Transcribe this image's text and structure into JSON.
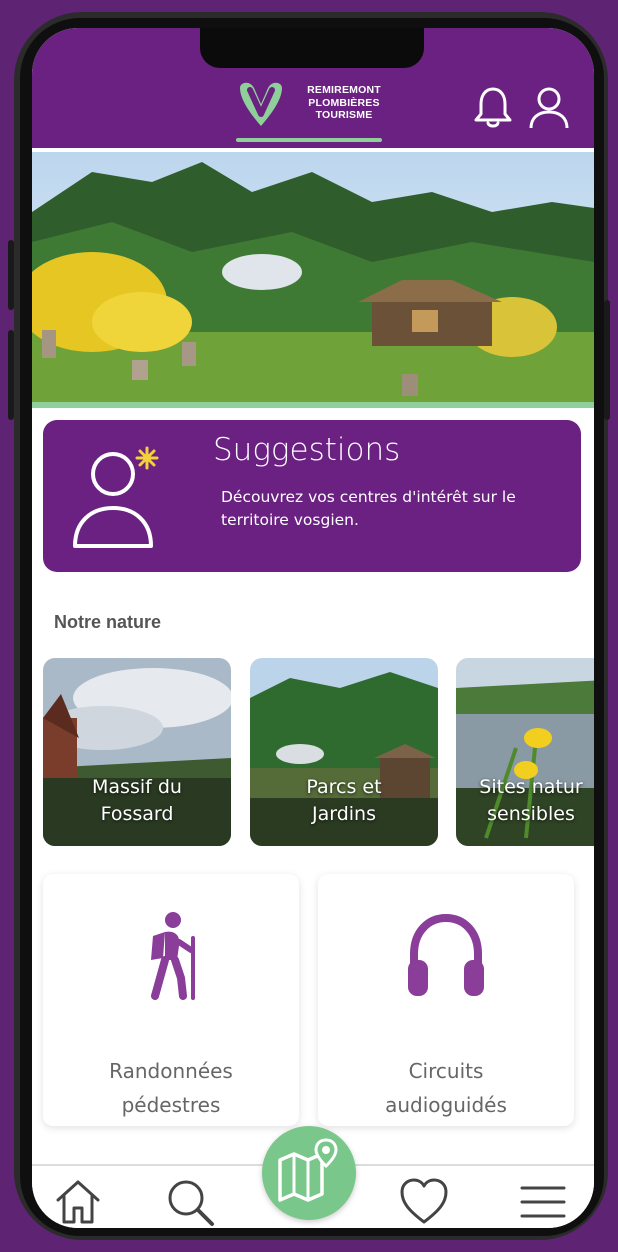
{
  "header": {
    "logo_lines": [
      "REMIREMONT",
      "PLOMBIÈRES",
      "TOURISME"
    ],
    "icons": [
      "bell-icon",
      "user-icon"
    ]
  },
  "hero": {
    "icon": "garden-photo"
  },
  "suggestions": {
    "title": "Suggestions",
    "text": "Découvrez vos centres d'intérêt sur le territoire vosgien.",
    "icon": "user-sparkle-icon"
  },
  "nature": {
    "title": "Notre nature",
    "cards": [
      {
        "label_lines": [
          "Massif du",
          "Fossard"
        ]
      },
      {
        "label_lines": [
          "Parcs et",
          "Jardins"
        ]
      },
      {
        "label_lines": [
          "Sites natur",
          "sensibles"
        ]
      }
    ]
  },
  "activities": [
    {
      "label_lines": [
        "Randonnées",
        "pédestres"
      ],
      "icon": "hiker-icon"
    },
    {
      "label_lines": [
        "Circuits",
        "audioguidés"
      ],
      "icon": "headphones-icon"
    }
  ],
  "bottom_nav": {
    "items": [
      "home-icon",
      "search-icon",
      "map-icon",
      "heart-icon",
      "menu-icon"
    ]
  },
  "colors": {
    "brand_purple": "#6a2181",
    "accent_green": "#79c78a",
    "background": "#5e2473"
  }
}
